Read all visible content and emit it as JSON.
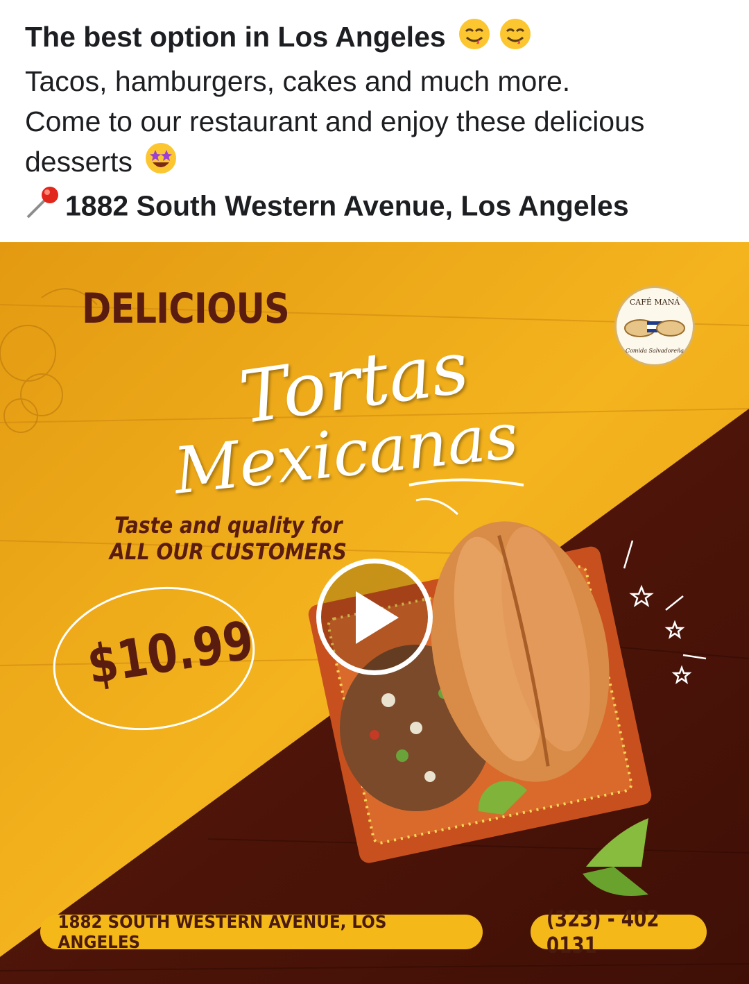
{
  "post": {
    "line1": "The best option in Los Angeles",
    "line2": "Tacos, hamburgers, cakes and much more.",
    "line3": "Come to our restaurant and enjoy these delicious",
    "line4": "desserts",
    "address_line": "1882 South Western Avenue, Los Angeles",
    "icons": [
      "savoring-face-emoji",
      "savoring-face-emoji",
      "star-struck-emoji",
      "round-pushpin-emoji"
    ]
  },
  "ad": {
    "headline": "DELICIOUS",
    "script_line1": "Tortas",
    "script_line2": "Mexicanas",
    "tagline_1": "Taste and quality for",
    "tagline_2": "ALL OUR CUSTOMERS",
    "price": "$10.99",
    "address_pill": "1882 SOUTH WESTERN AVENUE, LOS ANGELES",
    "phone_pill": "(323) - 402 0131",
    "logo_top": "CAFÉ MANÁ",
    "logo_bottom": "Comida Salvadoreña",
    "colors": {
      "mustard": "#f2ad1a",
      "maroon": "#5a1c0f",
      "plate": "#c8501e",
      "bun": "#d98c47"
    }
  },
  "media": {
    "play_button": "play-icon"
  }
}
